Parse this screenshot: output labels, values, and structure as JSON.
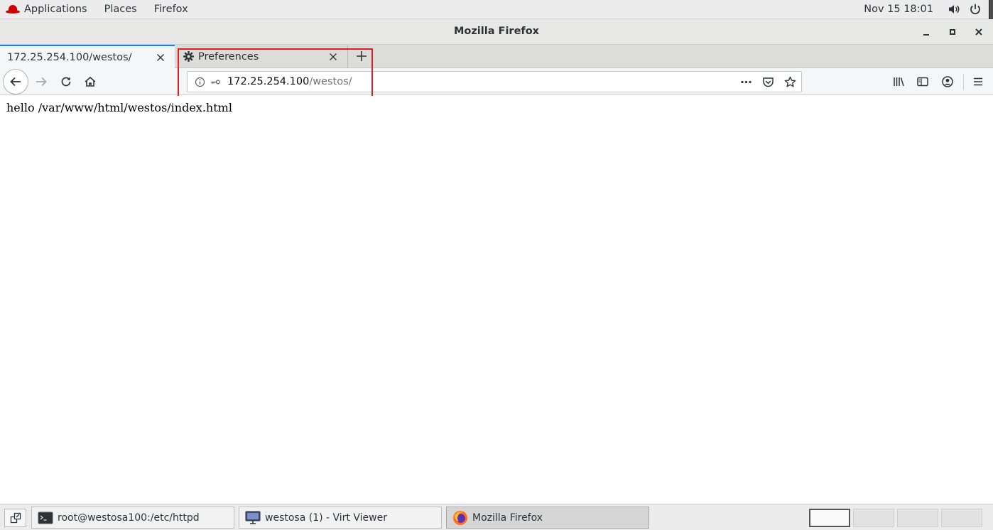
{
  "topbar": {
    "applications": "Applications",
    "places": "Places",
    "firefox": "Firefox",
    "datetime": "Nov 15  18:01"
  },
  "window": {
    "title": "Mozilla Firefox"
  },
  "tabs": [
    {
      "label": "172.25.254.100/westos/",
      "active": true
    },
    {
      "label": "Preferences",
      "active": false,
      "icon": "gear-icon"
    }
  ],
  "urlbar": {
    "host": "172.25.254.100",
    "path": "/westos/"
  },
  "page": {
    "text": "hello /var/www/html/westos/index.html"
  },
  "taskbar": {
    "tasks": [
      {
        "label": "root@westosa100:/etc/httpd",
        "icon": "terminal-icon"
      },
      {
        "label": "westosa (1) - Virt Viewer",
        "icon": "virt-viewer-icon"
      },
      {
        "label": "Mozilla Firefox",
        "icon": "firefox-icon",
        "active": true
      }
    ],
    "workspaces": 4,
    "current_workspace": 1
  },
  "colors": {
    "highlight": "#e02020",
    "active_tab_accent": "#0a84ff",
    "redhat": "#cc0000"
  }
}
